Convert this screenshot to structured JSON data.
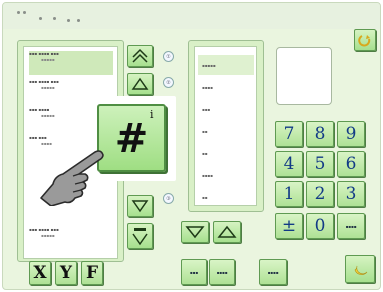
{
  "keypad": {
    "digits": [
      "7",
      "8",
      "9",
      "4",
      "5",
      "6",
      "1",
      "2",
      "3"
    ],
    "plus_minus": "±",
    "zero": "0"
  },
  "bottom_bar": {
    "x_label": "X",
    "y_label": "Y",
    "f_label": "F"
  },
  "overlay": {
    "hash_label": "#",
    "info_mark": "i"
  },
  "colors": {
    "button_fill": "#aee195",
    "panel_fill": "#d9f0c7",
    "key_digit": "#123b86"
  }
}
